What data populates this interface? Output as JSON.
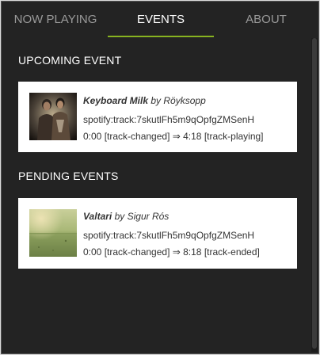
{
  "tabs": [
    {
      "label": "NOW PLAYING",
      "active": false
    },
    {
      "label": "EVENTS",
      "active": true
    },
    {
      "label": "ABOUT",
      "active": false
    }
  ],
  "accent_color": "#87b320",
  "upcoming": {
    "heading": "UPCOMING EVENT",
    "event": {
      "title": "Keyboard Milk",
      "by": "by Röyksopp",
      "uri": "spotify:track:7skutlFh5m9qOpfgZMSenH",
      "timing": "0:00 [track-changed] ⇒ 4:18 [track-playing]",
      "cover_icon": "album-cover-duo-portrait"
    }
  },
  "pending": {
    "heading": "PENDING EVENTS",
    "events": [
      {
        "title": "Valtari",
        "by": "by Sigur Rós",
        "uri": "spotify:track:7skutlFh5m9qOpfgZMSenH",
        "timing": "0:00 [track-changed] ⇒ 8:18 [track-ended]",
        "cover_icon": "album-cover-green-landscape"
      }
    ]
  }
}
